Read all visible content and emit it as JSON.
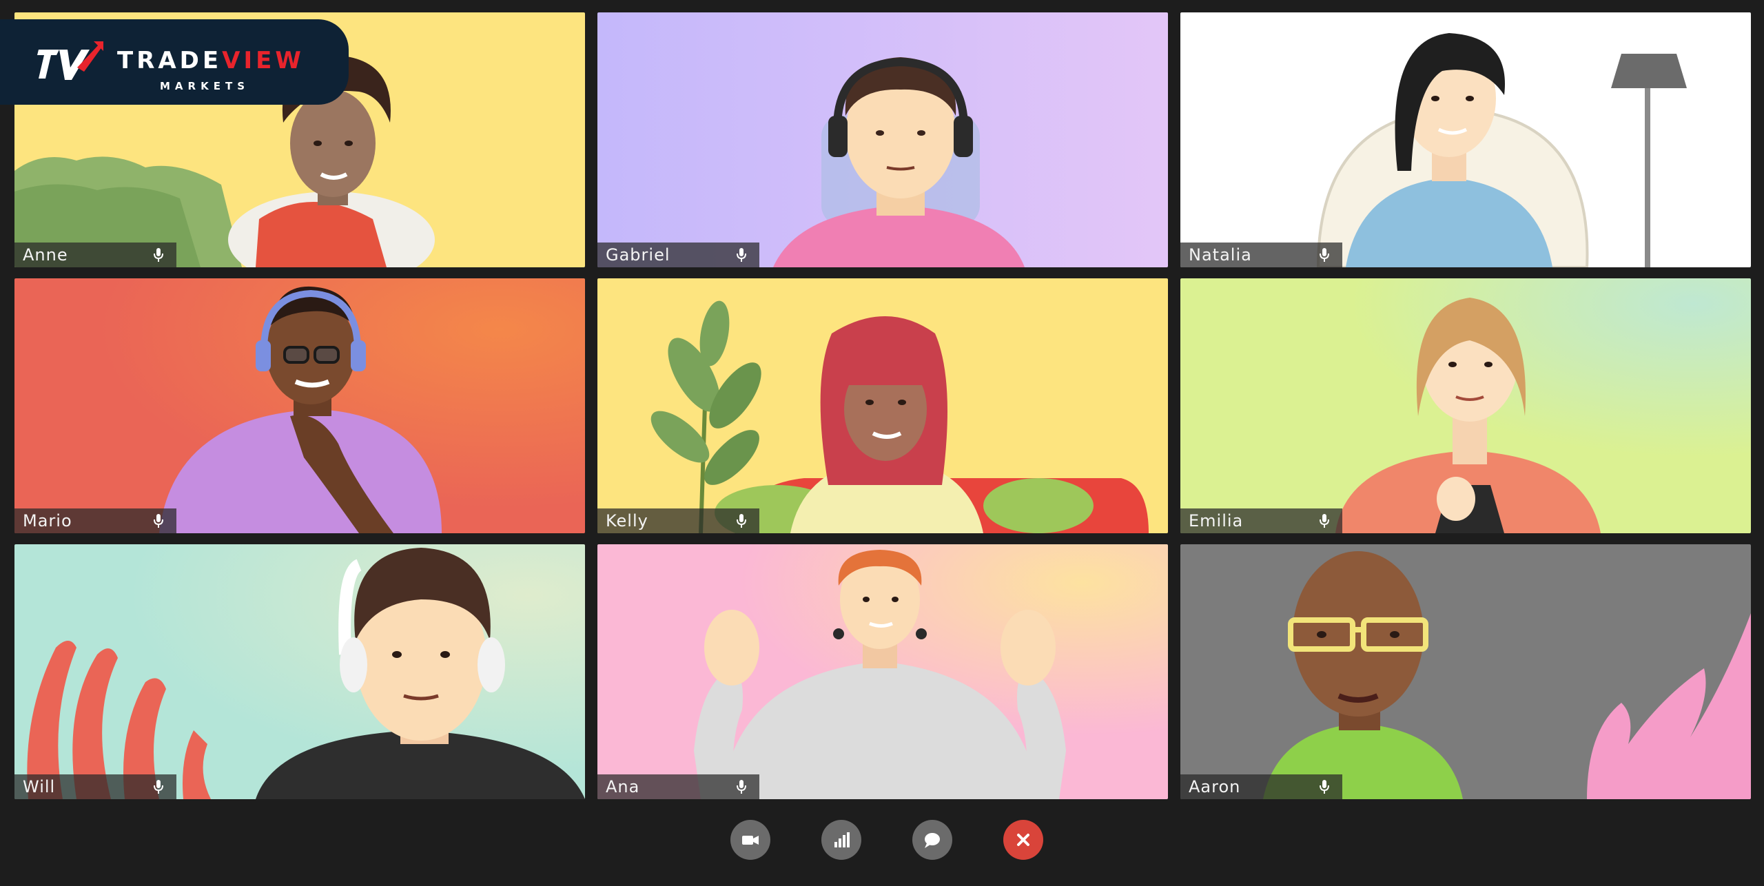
{
  "logo": {
    "brand_white": "TRADE",
    "brand_red": "VIEW",
    "sub": "MARKETS"
  },
  "participants": [
    {
      "name": "Anne",
      "bg": "#fde47f"
    },
    {
      "name": "Gabriel",
      "bg": "#c4b8fb"
    },
    {
      "name": "Natalia",
      "bg": "#ffffff"
    },
    {
      "name": "Mario",
      "bg": "#ea6556"
    },
    {
      "name": "Kelly",
      "bg": "#fde47f"
    },
    {
      "name": "Emilia",
      "bg": "#dbf192"
    },
    {
      "name": "Will",
      "bg": "#b4e5d8"
    },
    {
      "name": "Ana",
      "bg": "#fbb8d5"
    },
    {
      "name": "Aaron",
      "bg": "#7c7c7c"
    }
  ],
  "controls": [
    {
      "name": "camera-icon"
    },
    {
      "name": "signal-icon"
    },
    {
      "name": "chat-icon"
    },
    {
      "name": "close-icon"
    }
  ],
  "colors": {
    "end_call": "#d9443a",
    "control": "#6b6b6b",
    "background": "#1d1d1d"
  }
}
